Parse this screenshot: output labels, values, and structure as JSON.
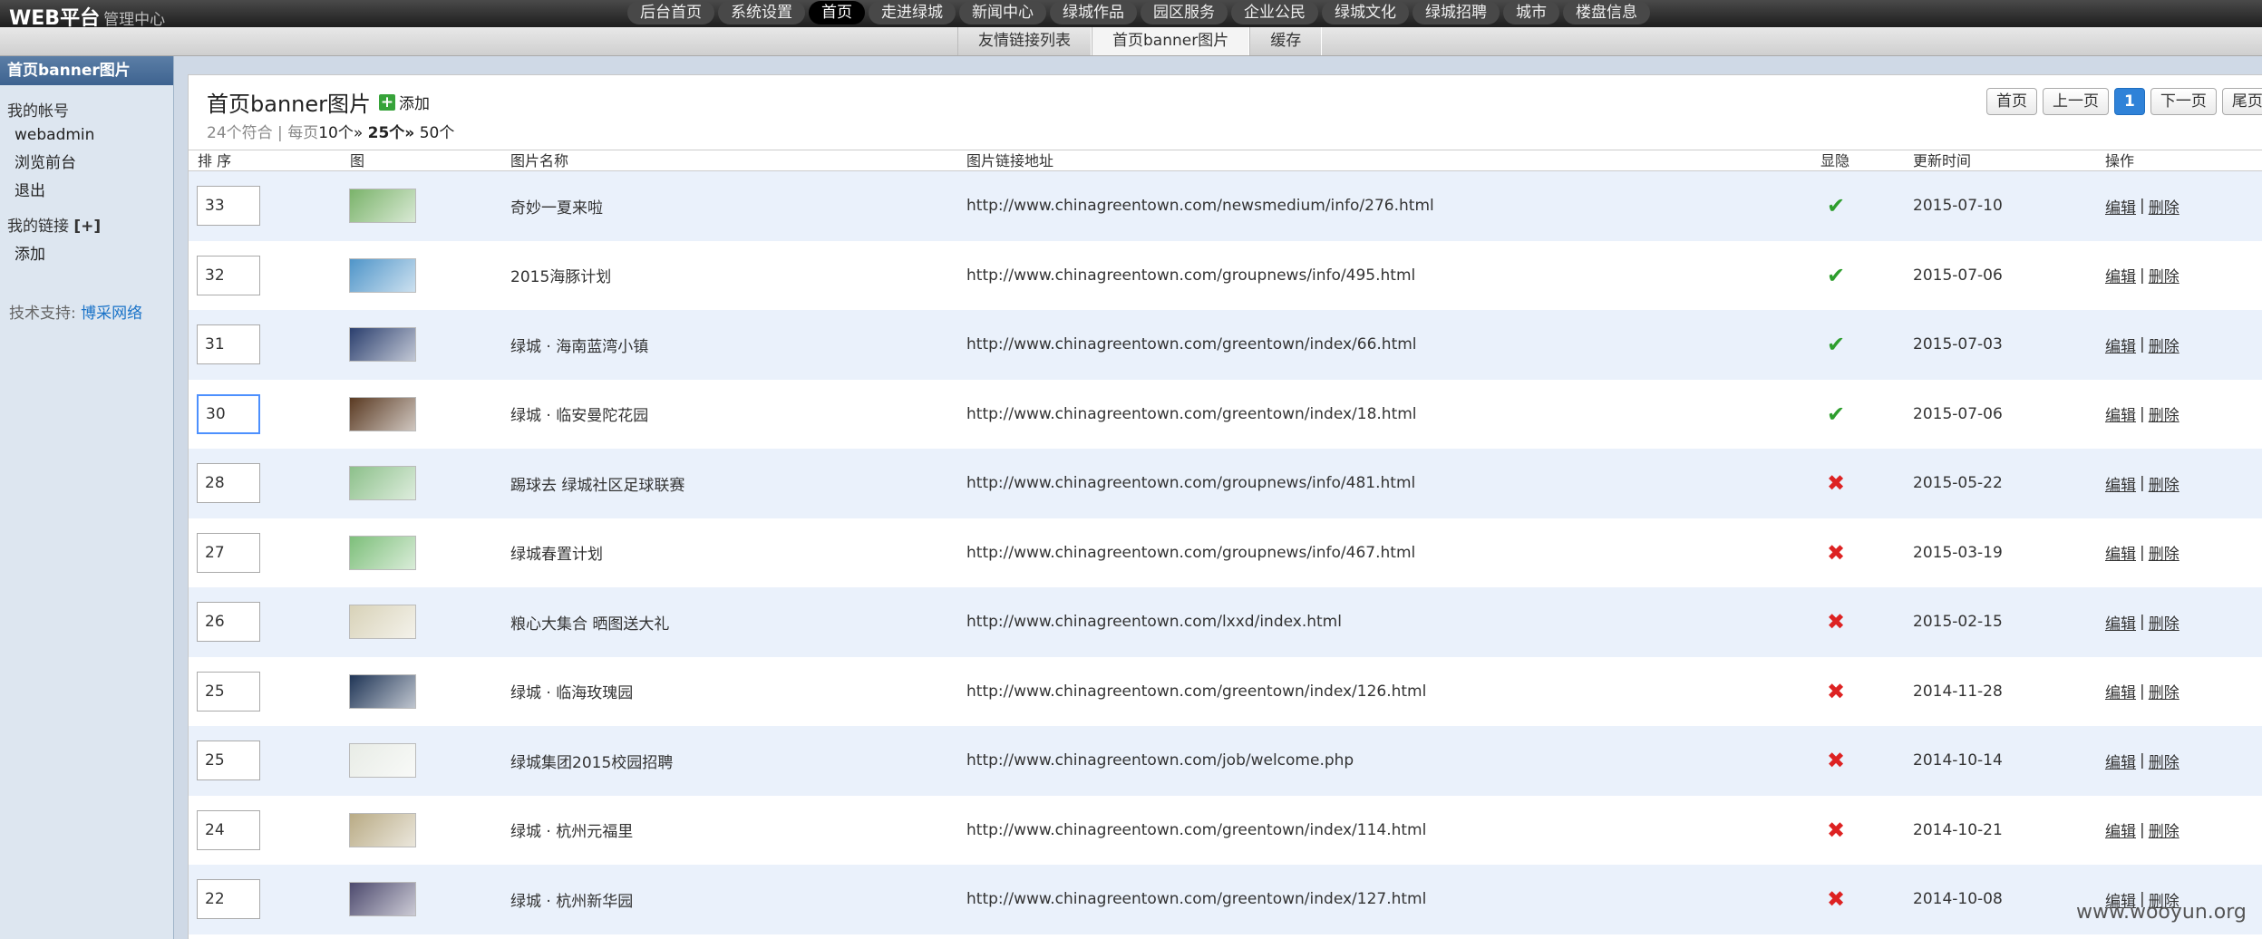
{
  "brand": {
    "title": "WEB平台",
    "subtitle": "管理中心"
  },
  "top_nav": [
    "后台首页",
    "系统设置",
    "首页",
    "走进绿城",
    "新闻中心",
    "绿城作品",
    "园区服务",
    "企业公民",
    "绿城文化",
    "绿城招聘",
    "城市",
    "楼盘信息"
  ],
  "top_nav_active": "首页",
  "sub_tabs": [
    "友情链接列表",
    "首页banner图片",
    "缓存"
  ],
  "sub_tab_active": "首页banner图片",
  "sidebar": {
    "header": "首页banner图片",
    "account_title": "我的帐号",
    "account_items": [
      "webadmin",
      "浏览前台",
      "退出"
    ],
    "links_title": "我的链接",
    "links_plus": "[+]",
    "links_items": [
      "添加"
    ],
    "support_label": "技术支持:",
    "support_link": "博采网络"
  },
  "main": {
    "title": "首页banner图片",
    "add_label": "添加",
    "meta": {
      "count": "24个符合",
      "sep": "|",
      "per_page": "每页",
      "opt10": "10个»",
      "opt25": "25个»",
      "opt50": "50个"
    }
  },
  "pager": {
    "first": "首页",
    "prev": "上一页",
    "current": "1",
    "next": "下一页",
    "last": "尾页"
  },
  "table": {
    "headers": {
      "order": "排 序",
      "image": "图",
      "name": "图片名称",
      "url": "图片链接地址",
      "visible": "显隐",
      "updated": "更新时间",
      "ops": "操作"
    },
    "ops": {
      "edit": "编辑",
      "sep": "|",
      "delete": "删除"
    },
    "rows": [
      {
        "order": "33",
        "name": "奇妙一夏来啦",
        "url": "http://www.chinagreentown.com/newsmedium/info/276.html",
        "visible": true,
        "updated": "2015-07-10",
        "thumb_color": "#7ab36a"
      },
      {
        "order": "32",
        "name": "2015海豚计划",
        "url": "http://www.chinagreentown.com/groupnews/info/495.html",
        "visible": true,
        "updated": "2015-07-06",
        "thumb_color": "#4f95c9"
      },
      {
        "order": "31",
        "name": "绿城 · 海南蓝湾小镇",
        "url": "http://www.chinagreentown.com/greentown/index/66.html",
        "visible": true,
        "updated": "2015-07-03",
        "thumb_color": "#2b3f6e"
      },
      {
        "order": "30",
        "name": "绿城 · 临安曼陀花园",
        "url": "http://www.chinagreentown.com/greentown/index/18.html",
        "visible": true,
        "updated": "2015-07-06",
        "thumb_color": "#5a3a22",
        "focused": true
      },
      {
        "order": "28",
        "name": "踢球去 绿城社区足球联赛",
        "url": "http://www.chinagreentown.com/groupnews/info/481.html",
        "visible": false,
        "updated": "2015-05-22",
        "thumb_color": "#8cc08a"
      },
      {
        "order": "27",
        "name": "绿城春置计划",
        "url": "http://www.chinagreentown.com/groupnews/info/467.html",
        "visible": false,
        "updated": "2015-03-19",
        "thumb_color": "#7dbf7a"
      },
      {
        "order": "26",
        "name": "粮心大集合 晒图送大礼",
        "url": "http://www.chinagreentown.com/lxxd/index.html",
        "visible": false,
        "updated": "2015-02-15",
        "thumb_color": "#d8d2b8"
      },
      {
        "order": "25",
        "name": "绿城 · 临海玫瑰园",
        "url": "http://www.chinagreentown.com/greentown/index/126.html",
        "visible": false,
        "updated": "2014-11-28",
        "thumb_color": "#1f3556"
      },
      {
        "order": "25",
        "name": "绿城集团2015校园招聘",
        "url": "http://www.chinagreentown.com/job/welcome.php",
        "visible": false,
        "updated": "2014-10-14",
        "thumb_color": "#e8ece6"
      },
      {
        "order": "24",
        "name": "绿城 · 杭州元福里",
        "url": "http://www.chinagreentown.com/greentown/index/114.html",
        "visible": false,
        "updated": "2014-10-21",
        "thumb_color": "#b9ab85"
      },
      {
        "order": "22",
        "name": "绿城 · 杭州新华园",
        "url": "http://www.chinagreentown.com/greentown/index/127.html",
        "visible": false,
        "updated": "2014-10-08",
        "thumb_color": "#4d4a6e"
      }
    ]
  },
  "watermark": "www.wooyun.org",
  "colors": {
    "accent": "#2f82d8",
    "ok": "#2e9e2e",
    "no": "#dd2222",
    "row_alt": "#eaf1fb"
  },
  "icons": {
    "visible_yes": "check-icon",
    "visible_no": "cross-icon",
    "add": "plus-icon"
  }
}
